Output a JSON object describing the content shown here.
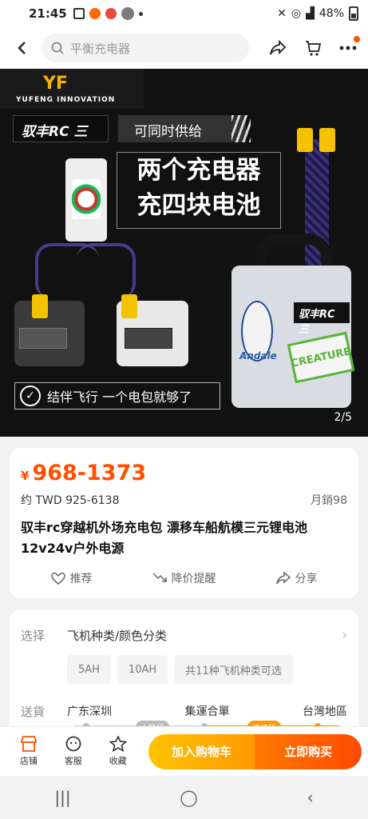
{
  "status_bar": {
    "time": "21:45",
    "battery": "48%"
  },
  "search": {
    "placeholder": "平衡充电器"
  },
  "hero": {
    "brand_name": "YUFENG INNOVATION",
    "badge": "驭丰RC 三",
    "tagline": "可同时供给",
    "headline_line1": "两个充电器",
    "headline_line2": "充四块电池",
    "slogan": "结伴飞行 一个电包就够了",
    "pack_label": "驭丰RC 三",
    "andale": "Andale",
    "creature": "CREATURE",
    "pager": "2/5"
  },
  "product": {
    "currency_symbol": "¥",
    "price_range": "968-1373",
    "twd": "约 TWD 925-6138",
    "monthly_sales": "月銷98",
    "title": "驭丰rc穿越机外场充电包 漂移车船航模三元锂电池12v24v户外电源",
    "actions": [
      "推荐",
      "降价提醒",
      "分享"
    ]
  },
  "specs": {
    "select_label": "选择",
    "select_value": "飞机种类/颜色分类",
    "options": [
      "5AH",
      "10AH",
      "共11种飞机种类可选"
    ],
    "ship_label": "送貨",
    "ship_points": [
      "广东深圳",
      "集運合單",
      "台灣地區"
    ],
    "ship_tags": [
      "大陸段",
      "跨境段"
    ]
  },
  "bottom_bar": {
    "items": [
      "店铺",
      "客服",
      "收藏"
    ],
    "cart_label": "加入购物车",
    "buy_label": "立即购买"
  },
  "colors": {
    "accent": "#ff5000",
    "cart": "#ffb000",
    "buy": "#ff5a00"
  }
}
